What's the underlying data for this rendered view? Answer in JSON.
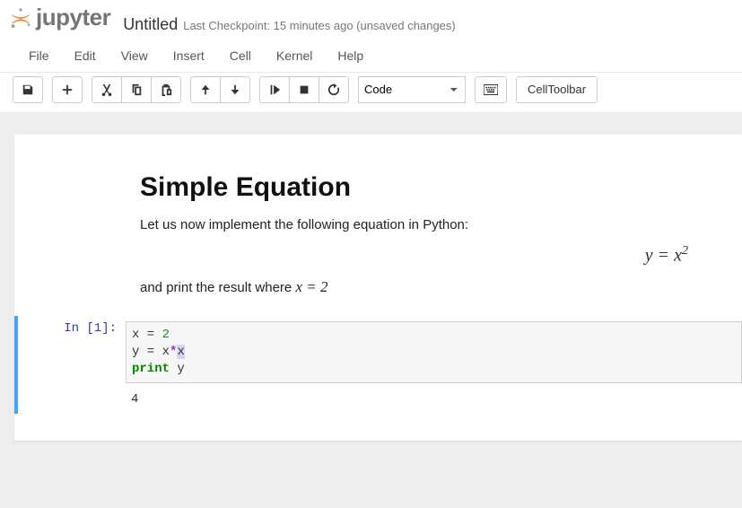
{
  "header": {
    "logo_text": "jupyter",
    "title": "Untitled",
    "checkpoint": "Last Checkpoint: 15 minutes ago (unsaved changes)"
  },
  "menu": {
    "file": "File",
    "edit": "Edit",
    "view": "View",
    "insert": "Insert",
    "cell": "Cell",
    "kernel": "Kernel",
    "help": "Help"
  },
  "toolbar": {
    "cell_type_selected": "Code",
    "cell_toolbar_label": "CellToolbar"
  },
  "markdown": {
    "heading": "Simple Equation",
    "p1": "Let us now implement the following equation in Python:",
    "eq_lhs": "y",
    "eq_eqs": " = ",
    "eq_rhs_base": "x",
    "eq_rhs_exp": "2",
    "p2_prefix": "and print the result where ",
    "p2_var": "x",
    "p2_eq": " = ",
    "p2_val": "2"
  },
  "code": {
    "prompt": "In [1]:",
    "line1_var": "x",
    "line1_eq": " = ",
    "line1_val": "2",
    "line2_var": "y",
    "line2_eq": " = ",
    "line2_a": "x",
    "line2_op": "*",
    "line2_b": "x",
    "line3_kw": "print",
    "line3_arg": " y",
    "output": "4"
  }
}
